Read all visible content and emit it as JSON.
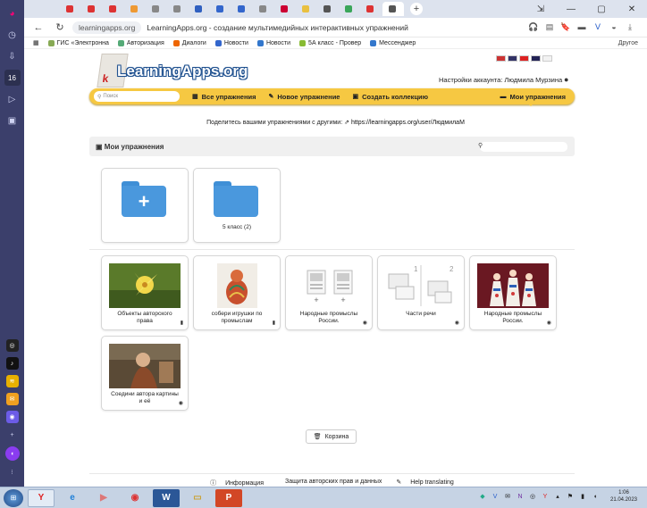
{
  "browser": {
    "tab_count_badge": "16",
    "tabs": [
      {
        "color": "#d33"
      },
      {
        "color": "#d33"
      },
      {
        "color": "#d33"
      },
      {
        "color": "#e93"
      },
      {
        "color": "#888"
      },
      {
        "color": "#888"
      },
      {
        "color": "#3060c0"
      },
      {
        "color": "#3366cc"
      },
      {
        "color": "#3366cc"
      },
      {
        "color": "#888"
      },
      {
        "color": "#c03"
      },
      {
        "color": "#e9c040"
      },
      {
        "color": "#555"
      },
      {
        "color": "#3aa65a"
      },
      {
        "color": "#d33"
      },
      {
        "color": "#555"
      }
    ],
    "url_host": "learningapps.org",
    "page_title": "LearningApps.org - создание мультимедийных интерактивных упражнений",
    "bookmarks": [
      {
        "label": "ГИС «Электронна",
        "color": "#8a5"
      },
      {
        "label": "Авторизация",
        "color": "#5a7"
      },
      {
        "label": "Диалоги",
        "color": "#e60"
      },
      {
        "label": "Новости",
        "color": "#36c"
      },
      {
        "label": "Новости",
        "color": "#37c"
      },
      {
        "label": "5А класс - Провер",
        "color": "#8b3"
      },
      {
        "label": "Мессенджер",
        "color": "#37c"
      }
    ],
    "bookmarks_other": "Другое",
    "window_controls": {
      "minimize": "—",
      "maximize": "▢",
      "close": "✕"
    }
  },
  "site": {
    "logo_text": "LearningApps.org",
    "flags": [
      "#c33",
      "#336",
      "#d22",
      "#225",
      "#f2f2f2"
    ],
    "account_label": "Настройки аккаунта: Людмила Мурзина",
    "search_placeholder": "Поиск",
    "nav": {
      "all": "Все упражнения",
      "new": "Новое упражнение",
      "collection": "Создать коллекцию",
      "mine": "Мои упражнения"
    },
    "share_text": "Поделитесь вашими упражнениями с другими:",
    "share_link": "https://learningapps.org/user/ЛюдмилаМ",
    "section_title": "Мои упражнения",
    "folders": [
      {
        "caption": ""
      },
      {
        "caption": "5 класс (2)"
      }
    ],
    "apps": [
      {
        "caption": "Объекты авторского права",
        "thumb": "photo-lily",
        "badge": "bookmark"
      },
      {
        "caption": "собери игрушки по промыслам",
        "thumb": "photo-toy",
        "badge": "bookmark"
      },
      {
        "caption": "Народные промыслы России.",
        "thumb": "template-pairs",
        "badge": "eye"
      },
      {
        "caption": "Части речи",
        "thumb": "template-groups",
        "badge": "eye"
      },
      {
        "caption": "Народные промыслы России.",
        "thumb": "photo-dolls",
        "badge": "eye"
      },
      {
        "caption": "Соедини автора картины и её",
        "thumb": "photo-painting",
        "badge": "eye"
      }
    ],
    "trash_label": "Корзина",
    "footer": {
      "info": "Информация",
      "copyright": "Защита авторских прав и данных",
      "translate": "Help translating"
    }
  },
  "taskbar": {
    "clock_time": "1:06",
    "clock_date": "21.04.2023"
  }
}
